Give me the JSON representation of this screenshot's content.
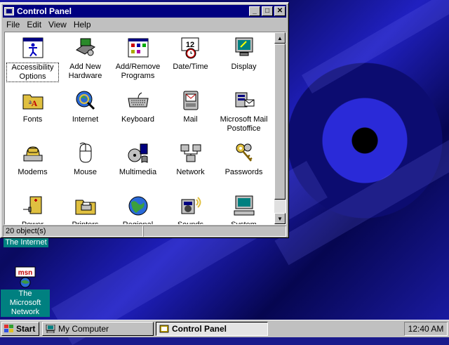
{
  "window": {
    "title": "Control Panel",
    "controls": {
      "minimize": "_",
      "maximize": "□",
      "close": "✕"
    },
    "menu": [
      "File",
      "Edit",
      "View",
      "Help"
    ],
    "status": "20 object(s)",
    "items": [
      {
        "label": "Accessibility Options",
        "icon": "accessibility-icon"
      },
      {
        "label": "Add New Hardware",
        "icon": "hardware-icon"
      },
      {
        "label": "Add/Remove Programs",
        "icon": "programs-icon"
      },
      {
        "label": "Date/Time",
        "icon": "calendar-clock-icon"
      },
      {
        "label": "Display",
        "icon": "display-icon"
      },
      {
        "label": "Fonts",
        "icon": "fonts-folder-icon"
      },
      {
        "label": "Internet",
        "icon": "globe-magnifier-icon"
      },
      {
        "label": "Keyboard",
        "icon": "keyboard-icon"
      },
      {
        "label": "Mail",
        "icon": "mail-icon"
      },
      {
        "label": "Microsoft Mail Postoffice",
        "icon": "postoffice-icon"
      },
      {
        "label": "Modems",
        "icon": "modem-phone-icon"
      },
      {
        "label": "Mouse",
        "icon": "mouse-icon"
      },
      {
        "label": "Multimedia",
        "icon": "multimedia-icon"
      },
      {
        "label": "Network",
        "icon": "network-icon"
      },
      {
        "label": "Passwords",
        "icon": "keys-icon"
      },
      {
        "label": "Power",
        "icon": "power-plug-icon"
      },
      {
        "label": "Printers",
        "icon": "printers-folder-icon"
      },
      {
        "label": "Regional",
        "icon": "globe-icon"
      },
      {
        "label": "Sounds",
        "icon": "speaker-icon"
      },
      {
        "label": "System",
        "icon": "computer-icon"
      }
    ]
  },
  "desktop": {
    "internet_label": "The Internet",
    "msn_label": "The Microsoft Network",
    "msn_logo_text": "msn"
  },
  "taskbar": {
    "start_label": "Start",
    "tasks": [
      {
        "label": "My Computer",
        "active": false
      },
      {
        "label": "Control Panel",
        "active": true
      }
    ],
    "clock": "12:40 AM"
  },
  "colors": {
    "titlebar": "#000080",
    "desktop": "#1a1a8c",
    "face": "#c0c0c0",
    "label_bg": "#008080"
  }
}
